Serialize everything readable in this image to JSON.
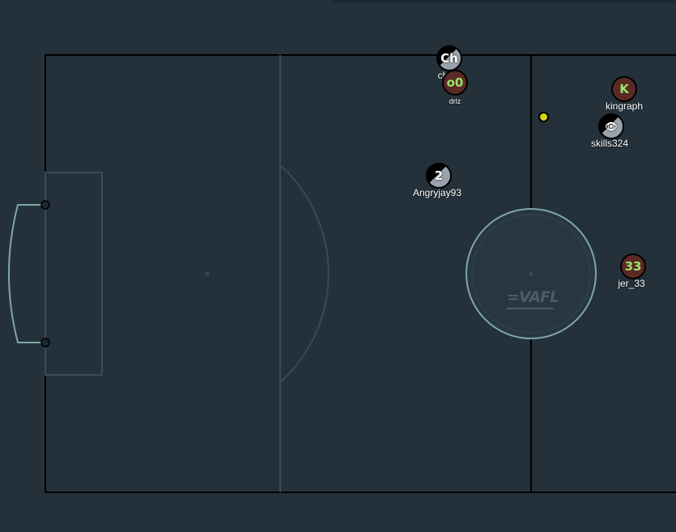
{
  "game": {
    "logo_text": "=VAFL",
    "colors": {
      "background": "#24313b",
      "pitch_line": "#000000",
      "area_line": "#3b4a55",
      "goal_line": "#7fa7a5",
      "center_circle": "#7fa7a5",
      "red_team": "#5b2a24",
      "red_team_text": "#9be36b",
      "ball": "#d9d214"
    },
    "ball": {
      "name": "ball"
    },
    "players": [
      {
        "name": "ch",
        "avatar": "Ch",
        "team": "grey",
        "label_visible": "ch"
      },
      {
        "name": "drlz",
        "avatar": "o0",
        "team": "red",
        "label_visible": "drlz"
      },
      {
        "name": "kingraph",
        "avatar": "K",
        "team": "red",
        "label_visible": "kingraph"
      },
      {
        "name": "skills324",
        "avatar": "👁",
        "team": "grey",
        "label_visible": "skills324"
      },
      {
        "name": "Angryjay93",
        "avatar": "2",
        "team": "grey",
        "label_visible": "Angryjay93"
      },
      {
        "name": "jer_33",
        "avatar": "33",
        "team": "red",
        "label_visible": "jer_33"
      }
    ]
  }
}
